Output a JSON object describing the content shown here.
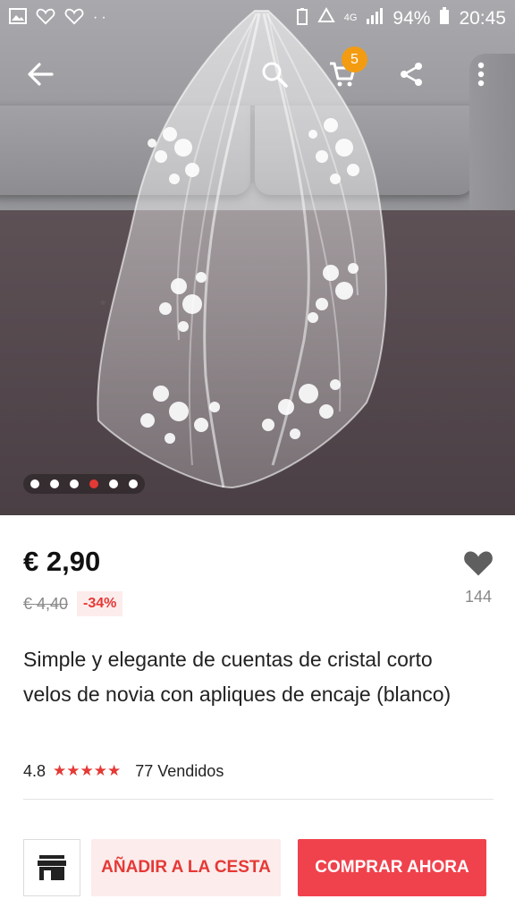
{
  "status_bar": {
    "battery": "94%",
    "time": "20:45",
    "network": "4G",
    "icons": [
      "gallery-icon",
      "heart-outline-icon",
      "heart-outline-icon",
      "more-notifications-icon",
      "battery-saver-icon",
      "sync-icon",
      "signal-icon",
      "battery-icon"
    ]
  },
  "app_bar": {
    "cart_count": "5",
    "icons": [
      "back-arrow-icon",
      "search-icon",
      "cart-icon",
      "share-icon",
      "more-vert-icon"
    ]
  },
  "carousel": {
    "total": 6,
    "active_index": 3
  },
  "product": {
    "price": "€ 2,90",
    "old_price": "€ 4,40",
    "discount": "-34%",
    "favorites": "144",
    "title": "Simple y elegante de cuentas de cristal corto velos de novia con apliques de encaje (blanco)",
    "rating": "4.8",
    "stars": "★★★★★",
    "sold": "77 Vendidos"
  },
  "actions": {
    "add_to_cart": "AÑADIR A LA CESTA",
    "buy_now": "COMPRAR AHORA"
  },
  "colors": {
    "accent": "#e53935",
    "buy_button": "#f0424d",
    "add_cart_bg": "#fdecec",
    "badge": "#f39c12"
  }
}
